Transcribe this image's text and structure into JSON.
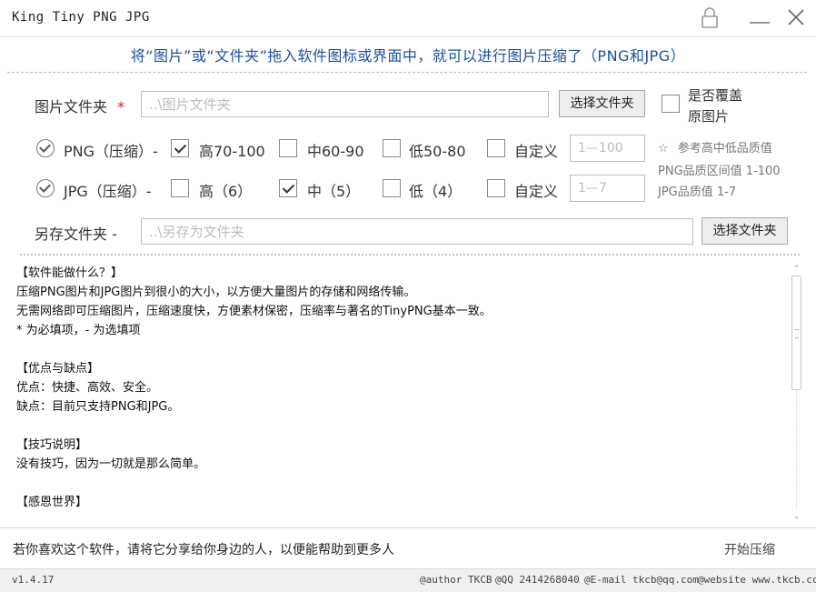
{
  "window": {
    "title": "King Tiny PNG JPG",
    "buttons": [
      "lock-icon",
      "minimize-icon",
      "close-icon"
    ]
  },
  "banner": "将“图片”或“文件夹”拖入软件图标或界面中，就可以进行图片压缩了（PNG和JPG）",
  "source": {
    "label": "图片文件夹",
    "required_mark": "*",
    "placeholder": "..\\图片文件夹",
    "choose_button": "选择文件夹",
    "overwrite_checked": false,
    "overwrite_label_line1": "是否覆盖",
    "overwrite_label_line2": "原图片"
  },
  "png": {
    "enabled": true,
    "label": "PNG（压缩）-",
    "options": [
      {
        "label": "高70-100",
        "checked": true
      },
      {
        "label": "中60-90",
        "checked": false
      },
      {
        "label": "低50-80",
        "checked": false
      },
      {
        "label": "自定义",
        "checked": false
      }
    ],
    "custom_placeholder": "1—100"
  },
  "jpg": {
    "enabled": true,
    "label": "JPG（压缩）-",
    "options": [
      {
        "label": "高（6）",
        "checked": false
      },
      {
        "label": "中（5）",
        "checked": true
      },
      {
        "label": "低（4）",
        "checked": false
      },
      {
        "label": "自定义",
        "checked": false
      }
    ],
    "custom_placeholder": "1—7"
  },
  "hints": {
    "star": "☆",
    "line1": "参考高中低品质值",
    "line2": "PNG品质区间值 1-100",
    "line3": "JPG品质值 1-7"
  },
  "output": {
    "label": "另存文件夹 -",
    "placeholder": "..\\另存为文件夹",
    "choose_button": "选择文件夹"
  },
  "info_lines": [
    "【软件能做什么？】",
    "压缩PNG图片和JPG图片到很小的大小，以方便大量图片的存储和网络传输。",
    "无需网络即可压缩图片，压缩速度快，方便素材保密，压缩率与著名的TinyPNG基本一致。",
    "* 为必填项，- 为选填项",
    "",
    "【优点与缺点】",
    "优点：快捷、高效、安全。",
    "缺点：目前只支持PNG和JPG。",
    "",
    "【技巧说明】",
    "没有技巧，因为一切就是那么简单。",
    "",
    "【感恩世界】"
  ],
  "footer": {
    "share_text": "若你喜欢这个软件，请将它分享给你身边的人，以便能帮助到更多人",
    "start_button": "开始压缩"
  },
  "status": {
    "version": "v1.4.17",
    "author": "@author TKCB",
    "qq": "@QQ 2414268040",
    "email": "@E-mail tkcb@qq.com",
    "website": "@website www.tkcb.cc"
  },
  "colors": {
    "banner_text": "#1a4f9c",
    "required_star": "#d31b1b"
  }
}
